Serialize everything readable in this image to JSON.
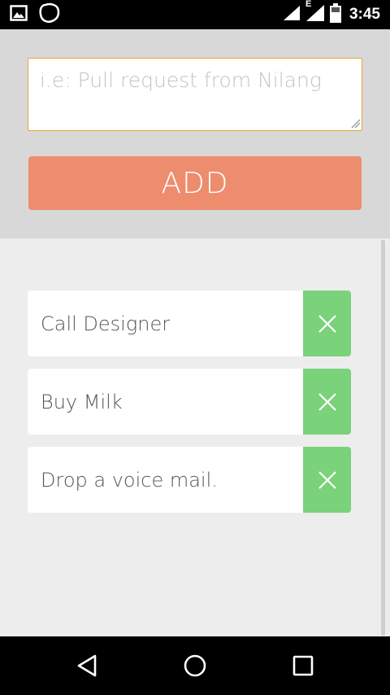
{
  "status_bar": {
    "time": "3:45",
    "network_label": "E"
  },
  "composer": {
    "placeholder": "i.e: Pull request from Nilang",
    "value": "",
    "add_label": "ADD"
  },
  "todos": [
    {
      "text": "Call Designer"
    },
    {
      "text": "Buy Milk"
    },
    {
      "text": "Drop a voice mail."
    }
  ],
  "icons": {
    "delete": "close-icon",
    "back": "back-triangle-icon",
    "home": "home-circle-icon",
    "recents": "recents-square-icon"
  },
  "colors": {
    "add_button": "#ee8c6e",
    "delete_button": "#7ad27a",
    "input_border": "#e6a531"
  }
}
